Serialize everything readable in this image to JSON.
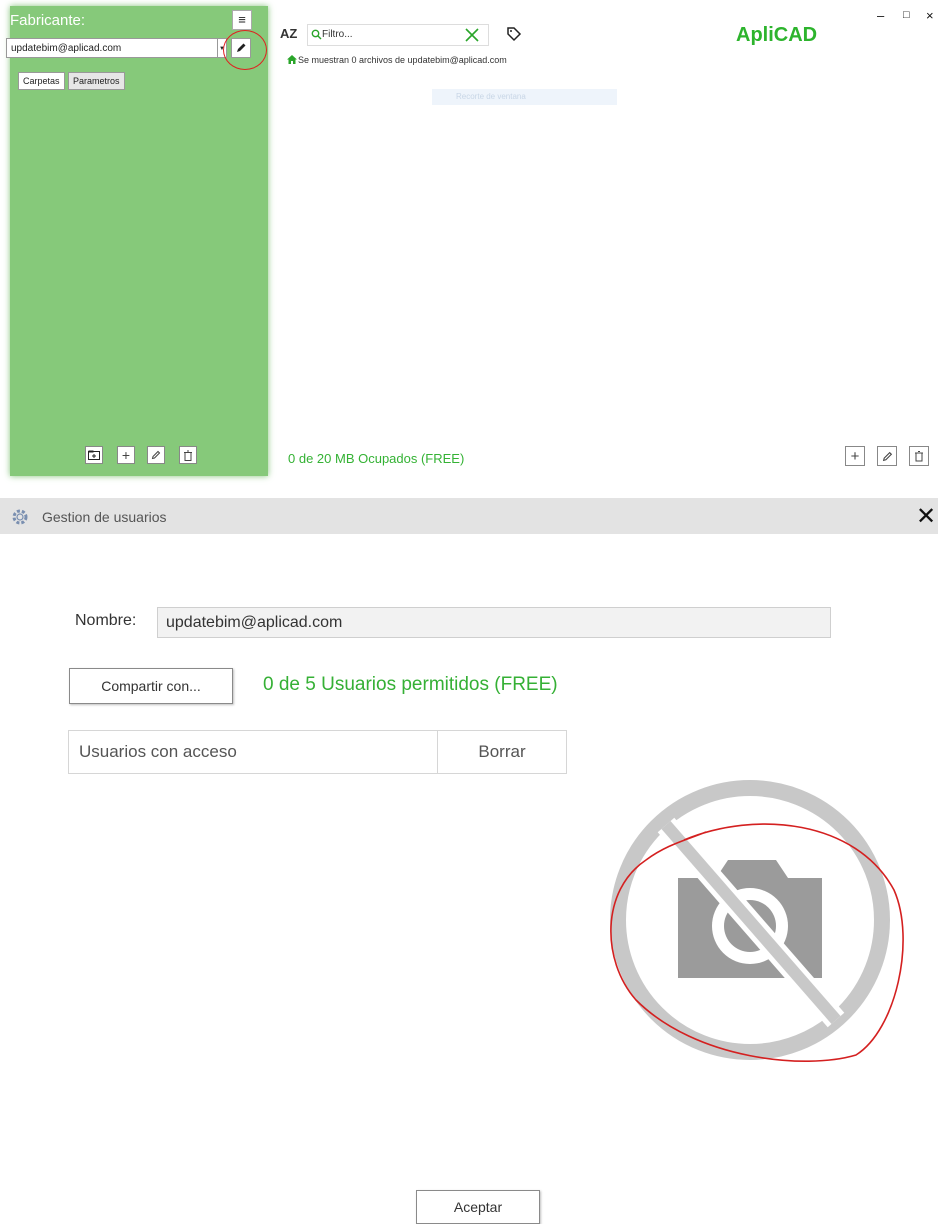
{
  "app": {
    "side_title": "Fabricante:",
    "selected_account": "updatebim@aplicad.com",
    "tabs": [
      "Carpetas",
      "Parametros"
    ],
    "filter_placeholder": "Filtro...",
    "breadcrumb": "Se muestran 0 archivos de updatebim@aplicad.com",
    "ghost_tooltip": "Recorte de ventana",
    "brand": "ApliCAD",
    "storage": "0 de 20  MB Ocupados (FREE)",
    "window_controls": {
      "minimize": "–",
      "maximize": "□",
      "close": "×"
    },
    "sort_label": "AZ"
  },
  "dialog": {
    "title": "Gestion de usuarios",
    "close_glyph": "✕",
    "name_label": "Nombre:",
    "name_value": "updatebim@aplicad.com",
    "share_button": "Compartir con...",
    "allowed_text": "0 de 5 Usuarios permitidos (FREE)",
    "columns": [
      "Usuarios con acceso",
      "Borrar"
    ],
    "accept_button": "Aceptar"
  },
  "colors": {
    "panel_green": "#86c97a",
    "accent_green": "#2db42d",
    "annotation_red": "#e02020"
  },
  "icons": [
    "menu-icon",
    "pencil-icon",
    "sort-az-icon",
    "search-icon",
    "clear-x-icon",
    "tag-icon",
    "home-icon",
    "new-folder-icon",
    "plus-icon",
    "trash-icon",
    "gear-icon",
    "no-image-icon"
  ]
}
